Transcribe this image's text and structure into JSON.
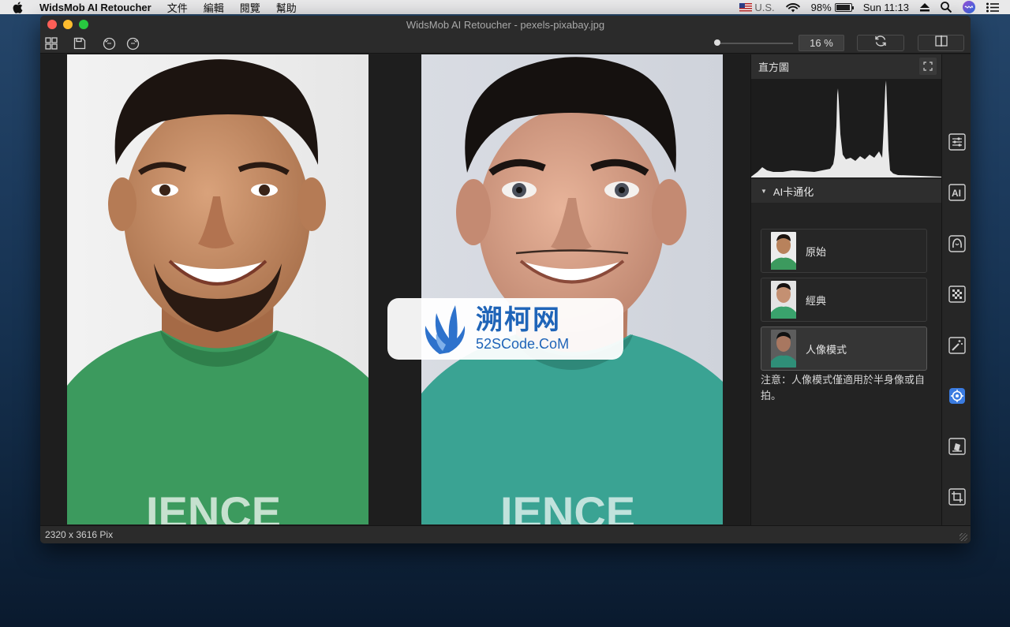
{
  "menubar": {
    "app_name": "WidsMob AI Retoucher",
    "menus": [
      "文件",
      "編輯",
      "閱覽",
      "幫助"
    ],
    "input_source": "U.S.",
    "battery": "98%",
    "battery_level": 0.98,
    "clock": "Sun 11:13"
  },
  "window": {
    "title": "WidsMob AI Retoucher - pexels-pixabay.jpg"
  },
  "toolbar": {
    "zoom_value": "16 %",
    "zoom_level": 0.0
  },
  "watermark": {
    "title": "溯柯网",
    "url": "52SCode.CoM"
  },
  "panel": {
    "histogram_title": "直方圖",
    "section_title": "AI卡通化",
    "styles": [
      {
        "label": "原始",
        "selected": false
      },
      {
        "label": "經典",
        "selected": false
      },
      {
        "label": "人像模式",
        "selected": true
      }
    ],
    "note": "注意：人像模式僅適用於半身像或自拍。"
  },
  "statusbar": {
    "dimensions": "2320 x 3616 Pix"
  },
  "side_tools": [
    "adjust-icon",
    "ai-icon",
    "face-icon",
    "mosaic-icon",
    "magic-wand-icon",
    "cartoon-icon",
    "stamp-icon",
    "crop-icon"
  ],
  "colors": {
    "shirt_green": "#3c9a5e",
    "shirt_teal": "#3aa393",
    "panel_bg": "#232323",
    "accent_blue": "#3a7be0"
  }
}
